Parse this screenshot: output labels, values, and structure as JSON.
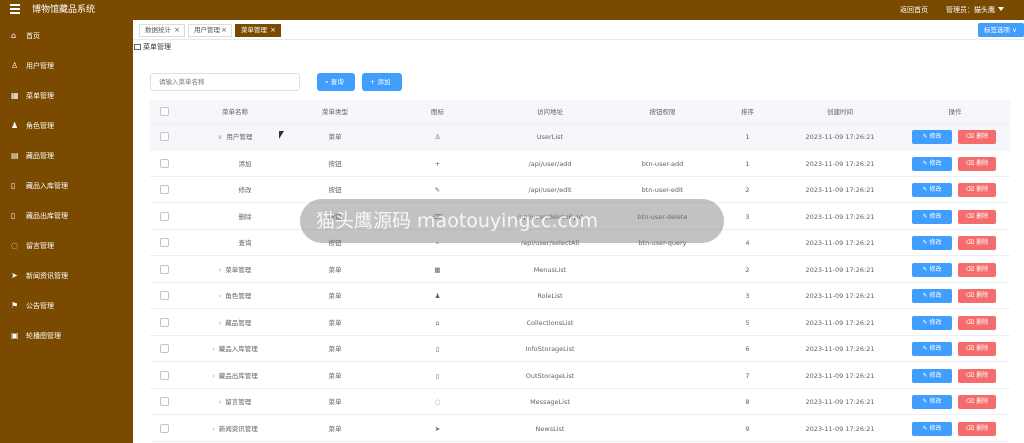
{
  "header": {
    "app_title": "博物馆藏品系统",
    "back_home": "返回首页",
    "admin_label": "管理员：猫头鹰"
  },
  "sidebar": {
    "items": [
      {
        "label": "首页",
        "icon": "home-icon"
      },
      {
        "label": "用户管理",
        "icon": "user-icon"
      },
      {
        "label": "菜单管理",
        "icon": "grid-icon"
      },
      {
        "label": "角色管理",
        "icon": "person-icon"
      },
      {
        "label": "藏品管理",
        "icon": "clipboard-icon"
      },
      {
        "label": "藏品入库管理",
        "icon": "document-icon"
      },
      {
        "label": "藏品出库管理",
        "icon": "document-icon"
      },
      {
        "label": "留言管理",
        "icon": "chat-icon"
      },
      {
        "label": "新闻资讯管理",
        "icon": "send-icon"
      },
      {
        "label": "公告管理",
        "icon": "flag-icon"
      },
      {
        "label": "轮播图管理",
        "icon": "image-icon"
      }
    ]
  },
  "tabs": [
    {
      "label": "数据统计"
    },
    {
      "label": "用户管理"
    },
    {
      "label": "菜单管理",
      "active": true
    }
  ],
  "tab_options": "标签选项",
  "breadcrumb": "菜单管理",
  "search": {
    "placeholder": "请输入菜单名称",
    "query_label": "查询",
    "add_label": "添加"
  },
  "table": {
    "columns": [
      "菜单名称",
      "菜单类型",
      "图标",
      "访问地址",
      "按钮权限",
      "排序",
      "创建时间",
      "操作"
    ],
    "edit_label": "修改",
    "delete_label": "删除",
    "rows": [
      {
        "name": "用户管理",
        "expand": "∨",
        "type": "菜单",
        "icon": "person-outline-icon",
        "url": "UserList",
        "perm": "",
        "sort": "1",
        "time": "2023-11-09 17:26:21"
      },
      {
        "name": "添加",
        "expand": "",
        "type": "按钮",
        "icon": "plus-icon",
        "url": "/api/user/add",
        "perm": "btn-user-add",
        "sort": "1",
        "time": "2023-11-09 17:26:21"
      },
      {
        "name": "修改",
        "expand": "",
        "type": "按钮",
        "icon": "edit-icon",
        "url": "/api/user/edit",
        "perm": "btn-user-edit",
        "sort": "2",
        "time": "2023-11-09 17:26:21"
      },
      {
        "name": "删除",
        "expand": "",
        "type": "按钮",
        "icon": "trash-icon",
        "url": "/api/user/deleteById",
        "perm": "btn-user-delete",
        "sort": "3",
        "time": "2023-11-09 17:26:21"
      },
      {
        "name": "查询",
        "expand": "",
        "type": "按钮",
        "icon": "search-icon",
        "url": "/api/user/selectAll",
        "perm": "btn-user-query",
        "sort": "4",
        "time": "2023-11-09 17:26:21"
      },
      {
        "name": "菜单管理",
        "expand": "›",
        "type": "菜单",
        "icon": "grid-icon",
        "url": "MenusList",
        "perm": "",
        "sort": "2",
        "time": "2023-11-09 17:26:21"
      },
      {
        "name": "角色管理",
        "expand": "›",
        "type": "菜单",
        "icon": "person-icon",
        "url": "RoleList",
        "perm": "",
        "sort": "3",
        "time": "2023-11-09 17:26:21"
      },
      {
        "name": "藏品管理",
        "expand": "›",
        "type": "菜单",
        "icon": "bank-icon",
        "url": "CollectionsList",
        "perm": "",
        "sort": "5",
        "time": "2023-11-09 17:26:21"
      },
      {
        "name": "藏品入库管理",
        "expand": "›",
        "type": "菜单",
        "icon": "document-icon",
        "url": "InfoStorageList",
        "perm": "",
        "sort": "6",
        "time": "2023-11-09 17:26:21"
      },
      {
        "name": "藏品出库管理",
        "expand": "›",
        "type": "菜单",
        "icon": "document-icon",
        "url": "OutStorageList",
        "perm": "",
        "sort": "7",
        "time": "2023-11-09 17:26:21"
      },
      {
        "name": "留言管理",
        "expand": "›",
        "type": "菜单",
        "icon": "chat-icon",
        "url": "MessageList",
        "perm": "",
        "sort": "8",
        "time": "2023-11-09 17:26:21"
      },
      {
        "name": "新闻资讯管理",
        "expand": "›",
        "type": "菜单",
        "icon": "send-icon",
        "url": "NewsList",
        "perm": "",
        "sort": "9",
        "time": "2023-11-09 17:26:21"
      }
    ]
  },
  "watermark": "猫头鹰源码 maotouyingcc.com",
  "colors": {
    "brand": "#7a4a00",
    "primary": "#409eff",
    "danger": "#f56c6c"
  }
}
